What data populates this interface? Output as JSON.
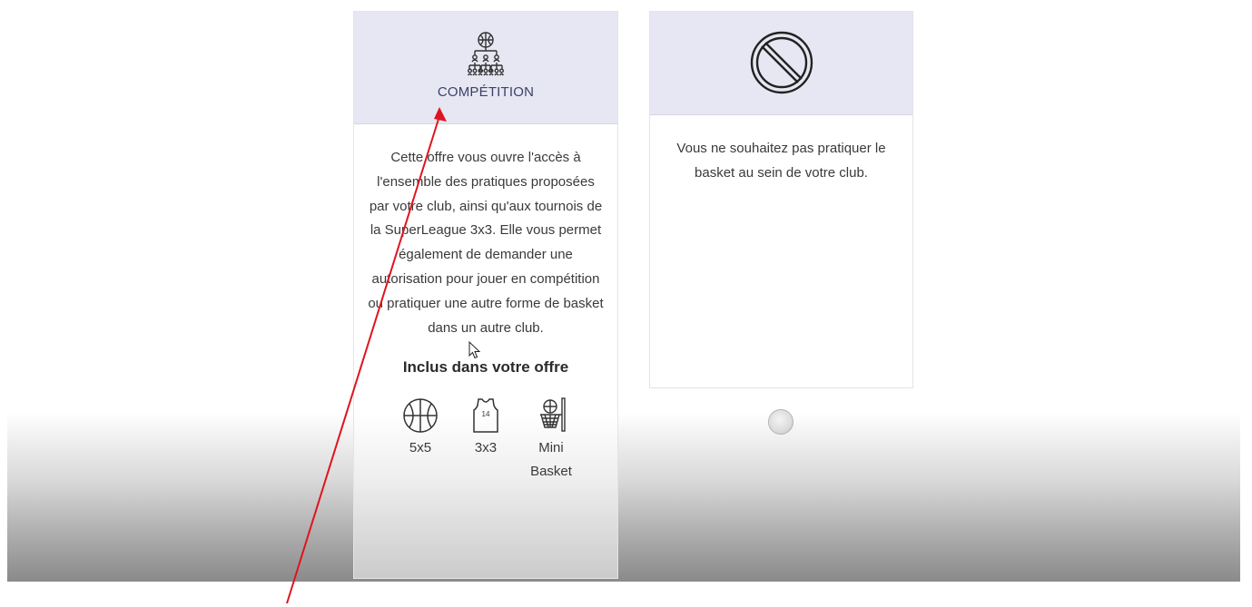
{
  "cards": [
    {
      "title": "COMPÉTITION",
      "description": "Cette offre vous ouvre l'accès à l'ensemble des pratiques proposées par votre club, ainsi qu'aux tournois de la SuperLeague 3x3. Elle vous permet également de demander une autorisation pour jouer en compétition ou pratiquer une autre forme de basket dans un autre club.",
      "included_title": "Inclus dans votre offre",
      "features": [
        {
          "label": "5x5",
          "icon": "basketball-icon"
        },
        {
          "label": "3x3",
          "icon": "jersey-icon"
        },
        {
          "label": "Mini Basket",
          "icon": "basket-hoop-icon"
        }
      ],
      "header_icon": "tournament-bracket-icon"
    },
    {
      "title": "",
      "description": "Vous ne souhaitez pas pratiquer le basket au sein de votre club.",
      "header_icon": "forbidden-icon"
    }
  ],
  "colors": {
    "header_bg": "#e7e7f3",
    "title": "#3b3f6b",
    "annotation_arrow": "#e0141e"
  }
}
